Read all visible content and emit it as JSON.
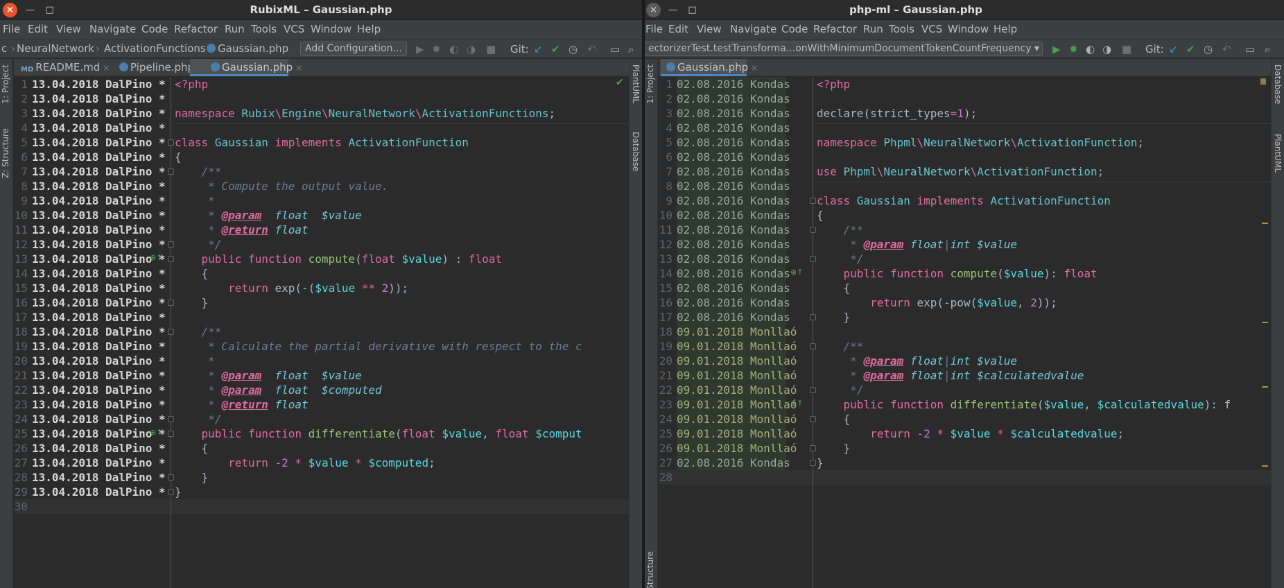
{
  "left": {
    "title": "RubixML – Gaussian.php",
    "menu": [
      "File",
      "Edit",
      "View",
      "Navigate",
      "Code",
      "Refactor",
      "Run",
      "Tools",
      "VCS",
      "Window",
      "Help"
    ],
    "breadcrumb": [
      "c",
      "NeuralNetwork",
      "ActivationFunctions",
      "Gaussian.php"
    ],
    "run_config": "Add Configuration...",
    "git_label": "Git:",
    "left_strip": [
      "1: Project",
      "Z: Structure"
    ],
    "right_strip": [
      "PlantUML",
      "Database"
    ],
    "tabs": [
      {
        "label": "README.md",
        "icon": "MD"
      },
      {
        "label": "Pipeline.php",
        "icon": "php-class-icon"
      },
      {
        "label": "Gaussian.php",
        "icon": "php-class-icon",
        "active": true
      }
    ],
    "annotation_text": "13.04.2018 DalPino *",
    "line_count": 30,
    "code": [
      [
        [
          "<?php",
          "t-php"
        ]
      ],
      [],
      [
        [
          "namespace ",
          "t-k"
        ],
        [
          "Rubix",
          "t-ns"
        ],
        [
          "\\",
          "t-op"
        ],
        [
          "Engine",
          "t-ns"
        ],
        [
          "\\",
          "t-op"
        ],
        [
          "NeuralNetwork",
          "t-ns"
        ],
        [
          "\\",
          "t-op"
        ],
        [
          "ActivationFunctions",
          "t-ns"
        ],
        [
          ";",
          ""
        ]
      ],
      [],
      [
        [
          "class ",
          "t-k"
        ],
        [
          "Gaussian ",
          "t-ns"
        ],
        [
          "implements ",
          "t-k"
        ],
        [
          "ActivationFunction",
          "t-ns"
        ]
      ],
      [
        [
          "{",
          ""
        ]
      ],
      [
        [
          "    /**",
          "t-cm"
        ]
      ],
      [
        [
          "     * Compute the output value.",
          "t-cm"
        ]
      ],
      [
        [
          "     *",
          "t-cm"
        ]
      ],
      [
        [
          "     * ",
          "t-cm"
        ],
        [
          "@param",
          "t-tag"
        ],
        [
          "  float  ",
          "t-ty"
        ],
        [
          "$value",
          "t-ty"
        ]
      ],
      [
        [
          "     * ",
          "t-cm"
        ],
        [
          "@return",
          "t-tag"
        ],
        [
          " float",
          "t-ty"
        ]
      ],
      [
        [
          "     */",
          "t-cm"
        ]
      ],
      [
        [
          "    public function ",
          "t-k"
        ],
        [
          "compute",
          "t-fn"
        ],
        [
          "(",
          ""
        ],
        [
          "float ",
          "t-k"
        ],
        [
          "$value",
          "t-var"
        ],
        [
          ") : ",
          ""
        ],
        [
          "float",
          "t-k"
        ]
      ],
      [
        [
          "    {",
          ""
        ]
      ],
      [
        [
          "        return ",
          "t-k"
        ],
        [
          "exp",
          ""
        ],
        [
          "(-(",
          ""
        ],
        [
          "$value",
          "t-var"
        ],
        [
          " ** ",
          "t-op"
        ],
        [
          "2",
          "t-num"
        ],
        [
          "));",
          ""
        ]
      ],
      [
        [
          "    }",
          ""
        ]
      ],
      [],
      [
        [
          "    /**",
          "t-cm"
        ]
      ],
      [
        [
          "     * Calculate the partial derivative with respect to the c",
          "t-cm"
        ]
      ],
      [
        [
          "     *",
          "t-cm"
        ]
      ],
      [
        [
          "     * ",
          "t-cm"
        ],
        [
          "@param",
          "t-tag"
        ],
        [
          "  float  ",
          "t-ty"
        ],
        [
          "$value",
          "t-ty"
        ]
      ],
      [
        [
          "     * ",
          "t-cm"
        ],
        [
          "@param",
          "t-tag"
        ],
        [
          "  float  ",
          "t-ty"
        ],
        [
          "$computed",
          "t-ty"
        ]
      ],
      [
        [
          "     * ",
          "t-cm"
        ],
        [
          "@return",
          "t-tag"
        ],
        [
          " float",
          "t-ty"
        ]
      ],
      [
        [
          "     */",
          "t-cm"
        ]
      ],
      [
        [
          "    public function ",
          "t-k"
        ],
        [
          "differentiate",
          "t-fn"
        ],
        [
          "(",
          ""
        ],
        [
          "float ",
          "t-k"
        ],
        [
          "$value",
          "t-var"
        ],
        [
          ", ",
          ""
        ],
        [
          "float ",
          "t-k"
        ],
        [
          "$comput",
          "t-var"
        ]
      ],
      [
        [
          "    {",
          ""
        ]
      ],
      [
        [
          "        return ",
          "t-k"
        ],
        [
          "-2",
          "t-num"
        ],
        [
          " * ",
          "t-op"
        ],
        [
          "$value",
          "t-var"
        ],
        [
          " * ",
          "t-op"
        ],
        [
          "$computed",
          "t-var"
        ],
        [
          ";",
          ""
        ]
      ],
      [
        [
          "    }",
          ""
        ]
      ],
      [
        [
          "}",
          ""
        ]
      ],
      []
    ]
  },
  "right": {
    "title": "php-ml – Gaussian.php",
    "menu": [
      "File",
      "Edit",
      "View",
      "Navigate",
      "Code",
      "Refactor",
      "Run",
      "Tools",
      "VCS",
      "Window",
      "Help"
    ],
    "run_config": "ectorizerTest.testTransforma...onWithMinimumDocumentTokenCountFrequency",
    "git_label": "Git:",
    "left_strip": [
      "1: Project",
      "Structure"
    ],
    "right_strip": [
      "Database",
      "PlantUML"
    ],
    "tabs": [
      {
        "label": "Gaussian.php",
        "icon": "php-class-icon",
        "active": true
      }
    ],
    "line_count": 28,
    "annotations": [
      "02.08.2016 Kondas",
      "02.08.2016 Kondas",
      "02.08.2016 Kondas",
      "02.08.2016 Kondas",
      "02.08.2016 Kondas",
      "02.08.2016 Kondas",
      "02.08.2016 Kondas",
      "02.08.2016 Kondas",
      "02.08.2016 Kondas",
      "02.08.2016 Kondas",
      "02.08.2016 Kondas",
      "02.08.2016 Kondas",
      "02.08.2016 Kondas",
      "02.08.2016 Kondas",
      "02.08.2016 Kondas",
      "02.08.2016 Kondas",
      "02.08.2016 Kondas",
      "09.01.2018 Monllaó",
      "09.01.2018 Monllaó",
      "09.01.2018 Monllaó",
      "09.01.2018 Monllaó",
      "09.01.2018 Monllaó",
      "09.01.2018 Monllaó",
      "09.01.2018 Monllaó",
      "09.01.2018 Monllaó",
      "09.01.2018 Monllaó",
      "02.08.2016 Kondas"
    ],
    "code": [
      [
        [
          "<?php",
          "t-php"
        ]
      ],
      [],
      [
        [
          "declare",
          ""
        ],
        [
          "(",
          ""
        ],
        [
          "strict_types",
          ""
        ],
        [
          "=",
          "t-op"
        ],
        [
          "1",
          "t-num"
        ],
        [
          ");",
          ""
        ]
      ],
      [],
      [
        [
          "namespace ",
          "t-k"
        ],
        [
          "Phpml",
          "t-ns"
        ],
        [
          "\\",
          "t-op"
        ],
        [
          "NeuralNetwork",
          "t-ns"
        ],
        [
          "\\",
          "t-op"
        ],
        [
          "ActivationFunction",
          "t-ns"
        ],
        [
          ";",
          ""
        ]
      ],
      [],
      [
        [
          "use ",
          "t-k"
        ],
        [
          "Phpml",
          "t-ns"
        ],
        [
          "\\",
          "t-op"
        ],
        [
          "NeuralNetwork",
          "t-ns"
        ],
        [
          "\\",
          "t-op"
        ],
        [
          "ActivationFunction",
          "t-ns"
        ],
        [
          ";",
          ""
        ]
      ],
      [],
      [
        [
          "class ",
          "t-k"
        ],
        [
          "Gaussian ",
          "t-ns"
        ],
        [
          "implements ",
          "t-k"
        ],
        [
          "ActivationFunction",
          "t-ns"
        ]
      ],
      [
        [
          "{",
          ""
        ]
      ],
      [
        [
          "    /**",
          "t-cm"
        ]
      ],
      [
        [
          "     * ",
          "t-cm"
        ],
        [
          "@param",
          "t-tag"
        ],
        [
          " float",
          "t-ty"
        ],
        [
          "|",
          "t-cm"
        ],
        [
          "int ",
          "t-ty"
        ],
        [
          "$value",
          "t-ty"
        ]
      ],
      [
        [
          "     */",
          "t-cm"
        ]
      ],
      [
        [
          "    public function ",
          "t-k"
        ],
        [
          "compute",
          "t-fn"
        ],
        [
          "(",
          ""
        ],
        [
          "$value",
          "t-var"
        ],
        [
          "): ",
          ""
        ],
        [
          "float",
          "t-k"
        ]
      ],
      [
        [
          "    {",
          ""
        ]
      ],
      [
        [
          "        return ",
          "t-k"
        ],
        [
          "exp",
          ""
        ],
        [
          "(-",
          ""
        ],
        [
          "pow",
          ""
        ],
        [
          "(",
          ""
        ],
        [
          "$value",
          "t-var"
        ],
        [
          ", ",
          ""
        ],
        [
          "2",
          "t-num"
        ],
        [
          "));",
          ""
        ]
      ],
      [
        [
          "    }",
          ""
        ]
      ],
      [],
      [
        [
          "    /**",
          "t-cm"
        ]
      ],
      [
        [
          "     * ",
          "t-cm"
        ],
        [
          "@param",
          "t-tag"
        ],
        [
          " float",
          "t-ty"
        ],
        [
          "|",
          "t-cm"
        ],
        [
          "int ",
          "t-ty"
        ],
        [
          "$value",
          "t-ty"
        ]
      ],
      [
        [
          "     * ",
          "t-cm"
        ],
        [
          "@param",
          "t-tag"
        ],
        [
          " float",
          "t-ty"
        ],
        [
          "|",
          "t-cm"
        ],
        [
          "int ",
          "t-ty"
        ],
        [
          "$calculatedvalue",
          "t-ty"
        ]
      ],
      [
        [
          "     */",
          "t-cm"
        ]
      ],
      [
        [
          "    public function ",
          "t-k"
        ],
        [
          "differentiate",
          "t-fn"
        ],
        [
          "(",
          ""
        ],
        [
          "$value",
          "t-var"
        ],
        [
          ", ",
          ""
        ],
        [
          "$calculatedvalue",
          "t-var"
        ],
        [
          "): f",
          ""
        ]
      ],
      [
        [
          "    {",
          ""
        ]
      ],
      [
        [
          "        return ",
          "t-k"
        ],
        [
          "-2",
          "t-num"
        ],
        [
          " * ",
          "t-op"
        ],
        [
          "$value",
          "t-var"
        ],
        [
          " * ",
          "t-op"
        ],
        [
          "$calculatedvalue",
          "t-var"
        ],
        [
          ";",
          ""
        ]
      ],
      [
        [
          "    }",
          ""
        ]
      ],
      [
        [
          "}",
          ""
        ]
      ],
      []
    ]
  }
}
